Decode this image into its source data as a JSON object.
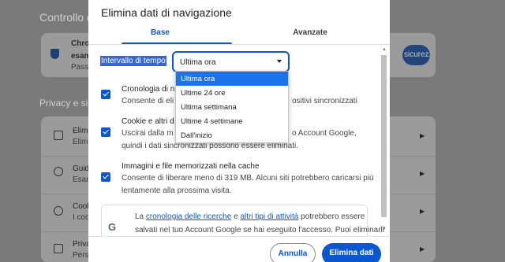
{
  "background": {
    "section1_title": "Controllo di s",
    "card1_title": "Chro",
    "card1_line2": "esam",
    "card1_line3": "Passw",
    "card1_button": "sicurezza",
    "section2_title": "Privacy e sicu",
    "rows": [
      {
        "title": "Elimi",
        "sub": "Elimi"
      },
      {
        "title": "Guid",
        "sub": "Esam"
      },
      {
        "title": "Cook",
        "sub": "I coo"
      },
      {
        "title": "Priva",
        "sub": "Perso"
      }
    ]
  },
  "dialog": {
    "title": "Elimina dati di navigazione",
    "tabs": [
      "Base",
      "Avanzate"
    ],
    "time_range_label": "Intervallo di tempo",
    "time_range_value": "Ultima ora",
    "dropdown_options": [
      "Ultima ora",
      "Ultime 24 ore",
      "Ultima settimana",
      "Ultime 4 settimane",
      "Dall'inizio"
    ],
    "options": [
      {
        "title": "Cronologia di n",
        "desc1": "Consente di eli",
        "desc1_tail": "ositivi sincronizzati",
        "checked": true
      },
      {
        "title": "Cookie e altri d",
        "desc1": "Uscirai dalla m",
        "desc1_tail": "o Account Google,",
        "desc2": "quindi i dati sincronizzati possono essere eliminati.",
        "checked": true
      },
      {
        "title": "Immagini e file memorizzati nella cache",
        "desc1": "Consente di liberare meno di 319 MB. Alcuni siti potrebbero caricarsi più",
        "desc2": "lentamente alla prossima visita.",
        "checked": true
      }
    ],
    "info": {
      "part1": "La ",
      "link1": "cronologia delle ricerche",
      "part2": " e ",
      "link2": "altri tipi di attività",
      "part3": " potrebbero essere",
      "line2": "salvati nel tuo Account Google se hai eseguito l'accesso. Puoi eliminarli"
    },
    "cancel_label": "Annulla",
    "delete_label": "Elimina dati"
  },
  "colors": {
    "accent": "#0b57d0",
    "overlay": "#7a7a7a"
  }
}
